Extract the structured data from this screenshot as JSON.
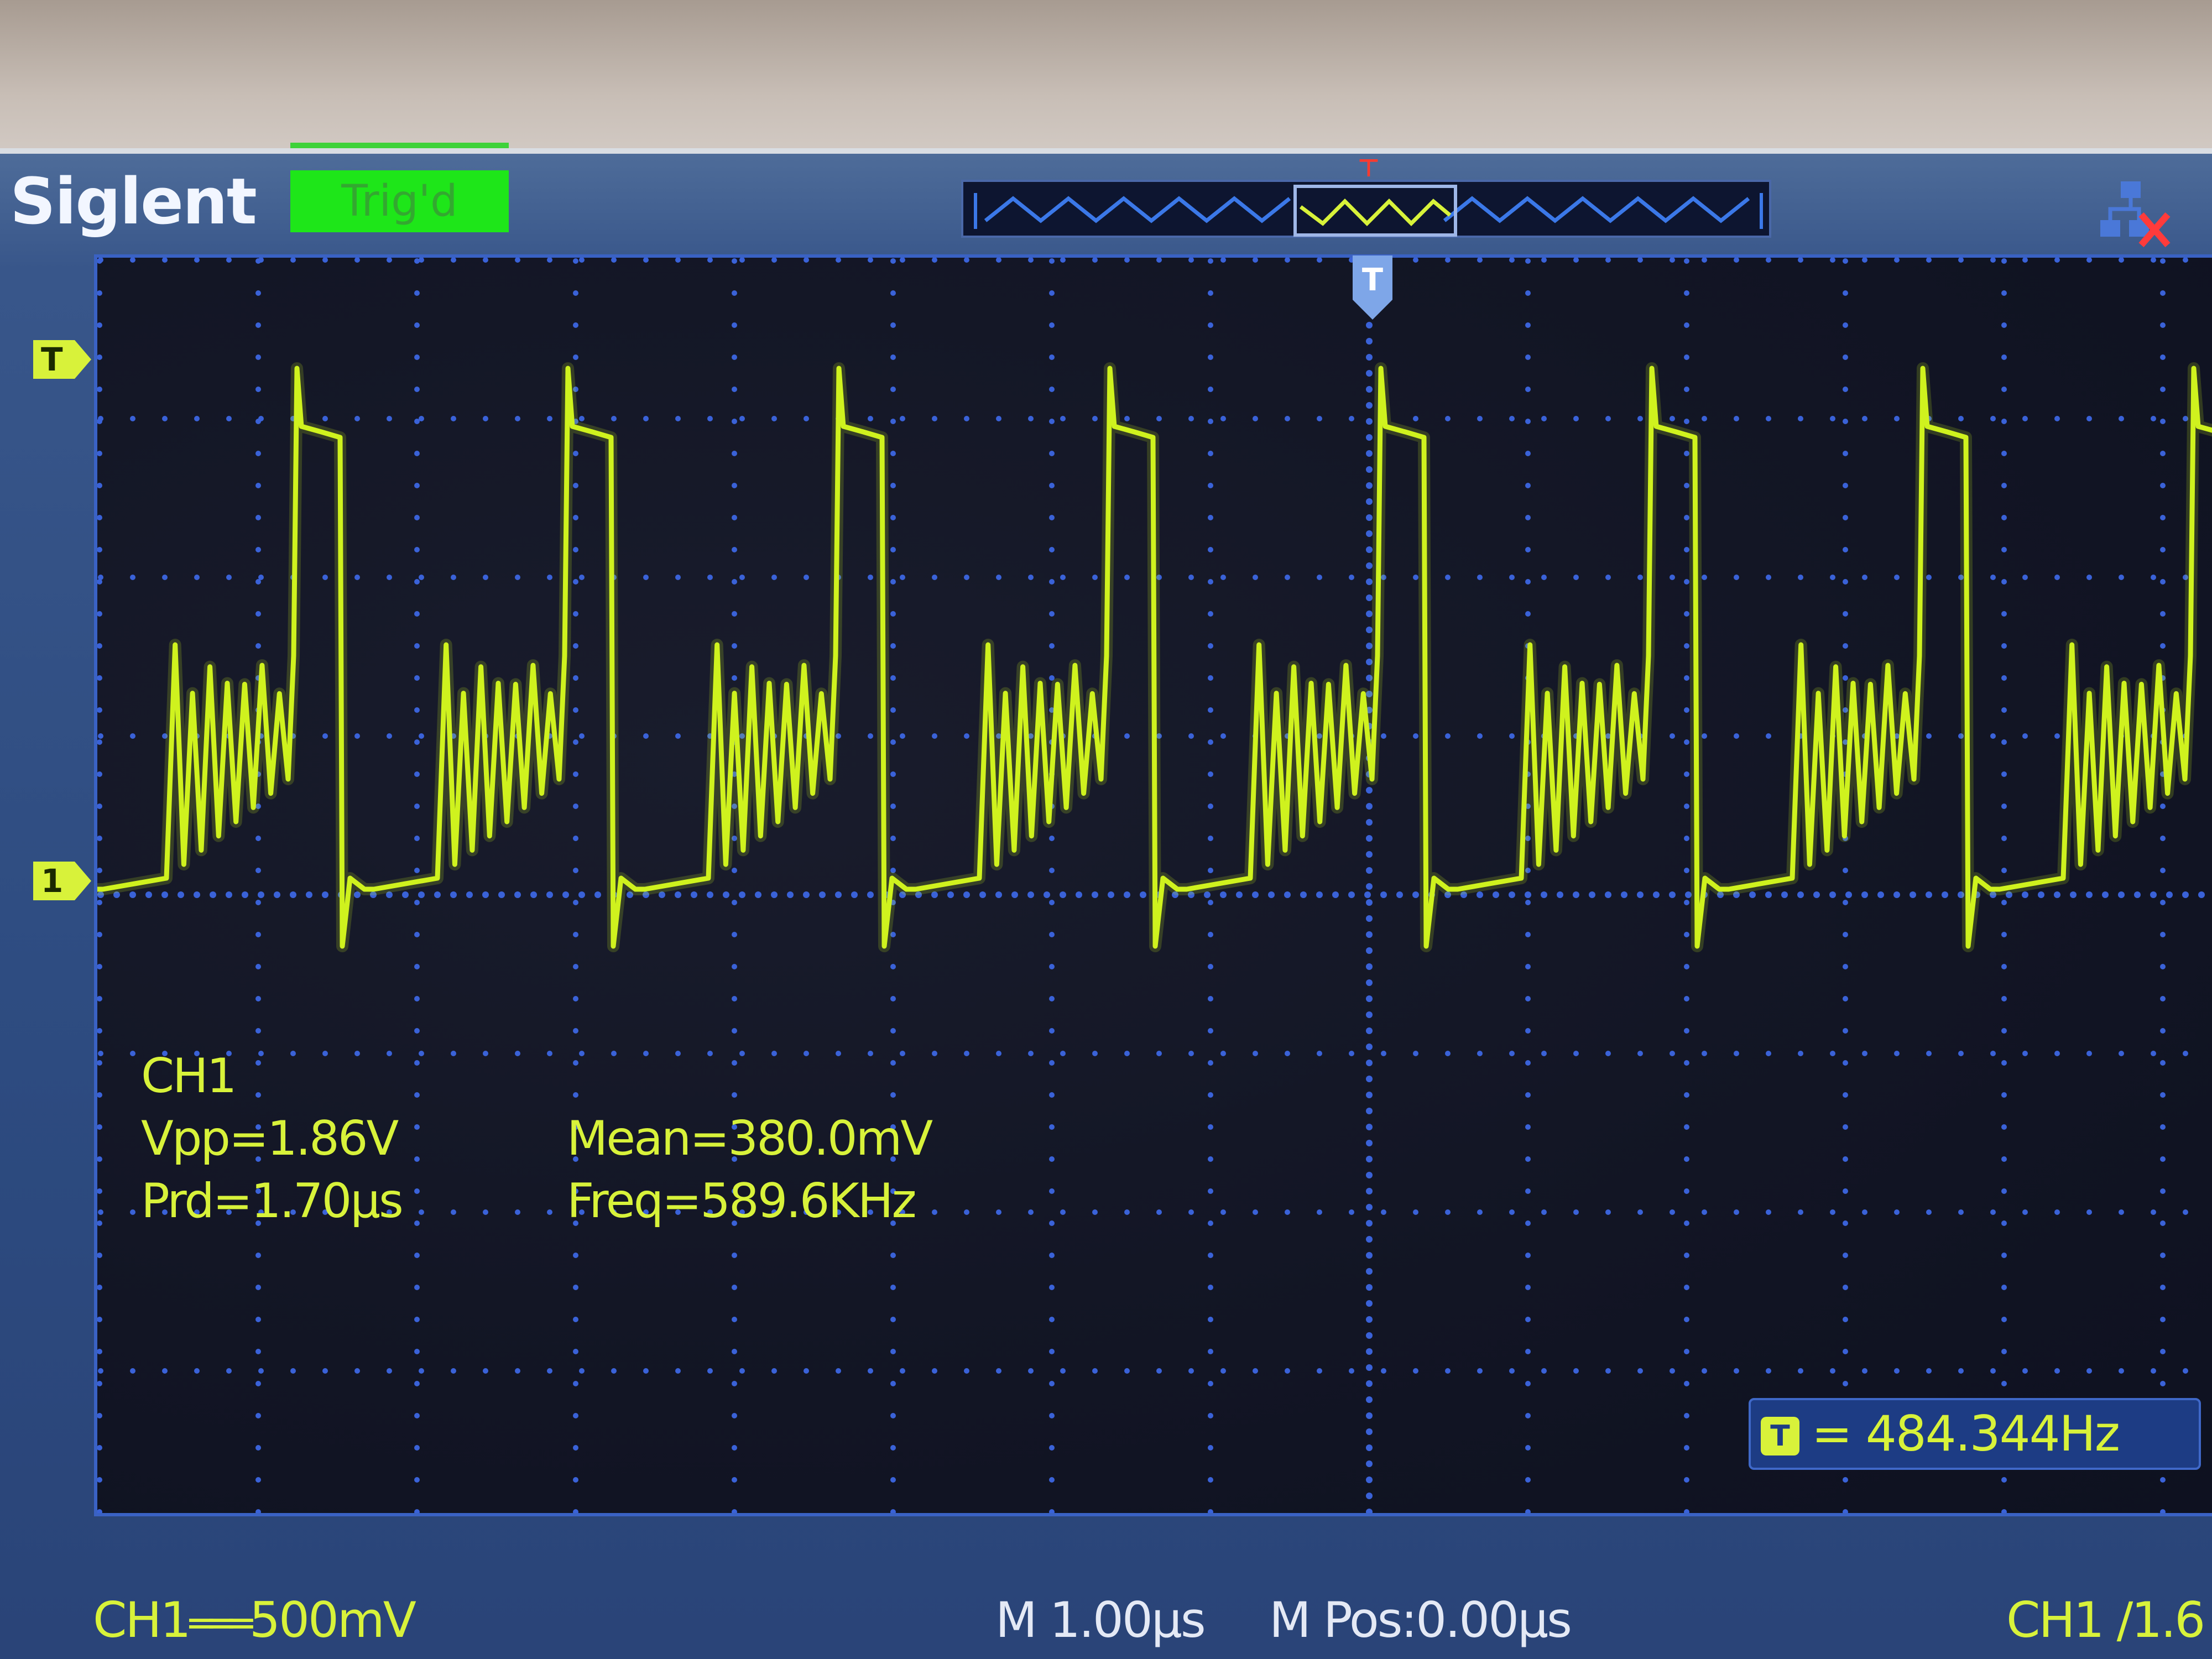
{
  "brand": "Siglent",
  "status_text": "Trig'd",
  "trigger_marker_label": "T",
  "channel_marker_label": "1",
  "measurements": {
    "channel": "CH1",
    "vpp": "Vpp=1.86V",
    "period": "Prd=1.70µs",
    "mean": "Mean=380.0mV",
    "frequency": "Freq=589.6KHz"
  },
  "frequency_counter": {
    "icon_label": "T",
    "value": "= 484.344Hz"
  },
  "bottom_bar": {
    "channel_scale_prefix": "CH1",
    "channel_scale_coupling": "═══",
    "channel_scale_value": "500mV",
    "timebase": "M 1.00µs",
    "horizontal_position": "M Pos:0.00µs",
    "trigger_info": "CH1 ∕1.6"
  },
  "colors": {
    "trace": "#cff21e",
    "grid": "#3a62d8",
    "status_background": "#1ee619",
    "bezel": "#2d4b80"
  },
  "icons": {
    "network": "network-disconnected-icon",
    "trigger": "trigger-marker-icon"
  },
  "waveform": {
    "bursts_visible": 8,
    "oscillations_per_burst": 7,
    "period_divisions": 1.7
  }
}
